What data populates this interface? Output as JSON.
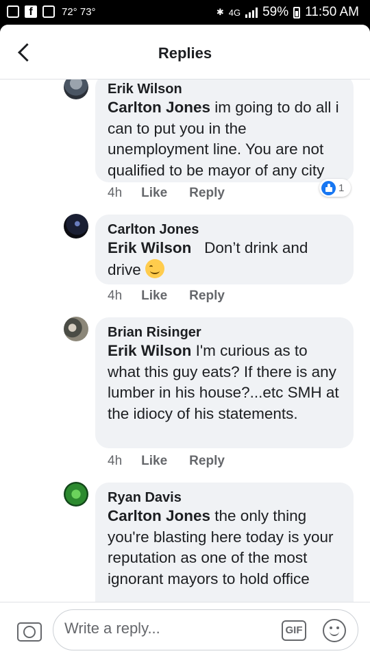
{
  "status_bar": {
    "temperature": "72° 73°",
    "network": "4G",
    "battery": "59%",
    "time": "11:50 AM"
  },
  "header": {
    "title": "Replies",
    "back_icon": "chevron-left-icon"
  },
  "comments": [
    {
      "author": "Erik Wilson",
      "mention": "Carlton Jones",
      "text": " im going to do all i can to put you in the unemployment line. You are not qualified to be mayor of any city",
      "time": "4h",
      "like_label": "Like",
      "reply_label": "Reply",
      "reaction_icon": "like-icon",
      "reaction_count": "1"
    },
    {
      "author": "Carlton Jones",
      "mention": "Erik Wilson",
      "text": "   Don’t drink and drive ",
      "emoji": "smiling-face",
      "time": "4h",
      "like_label": "Like",
      "reply_label": "Reply"
    },
    {
      "author": "Brian Risinger",
      "mention": "Erik Wilson",
      "text": " I'm curious as to what this guy eats? If there is any lumber in his house?...etc SMH at the idiocy of his statements.",
      "time": "4h",
      "like_label": "Like",
      "reply_label": "Reply"
    },
    {
      "author": "Ryan Davis",
      "mention": "Carlton Jones",
      "text": " the only thing you're blasting here today is your reputation as one of the most ignorant mayors to hold office",
      "time": "",
      "like_label": "",
      "reply_label": ""
    }
  ],
  "composer": {
    "placeholder": "Write a reply...",
    "gif_label": "GIF",
    "camera_icon": "camera-icon",
    "emoji_icon": "smiley-icon"
  }
}
